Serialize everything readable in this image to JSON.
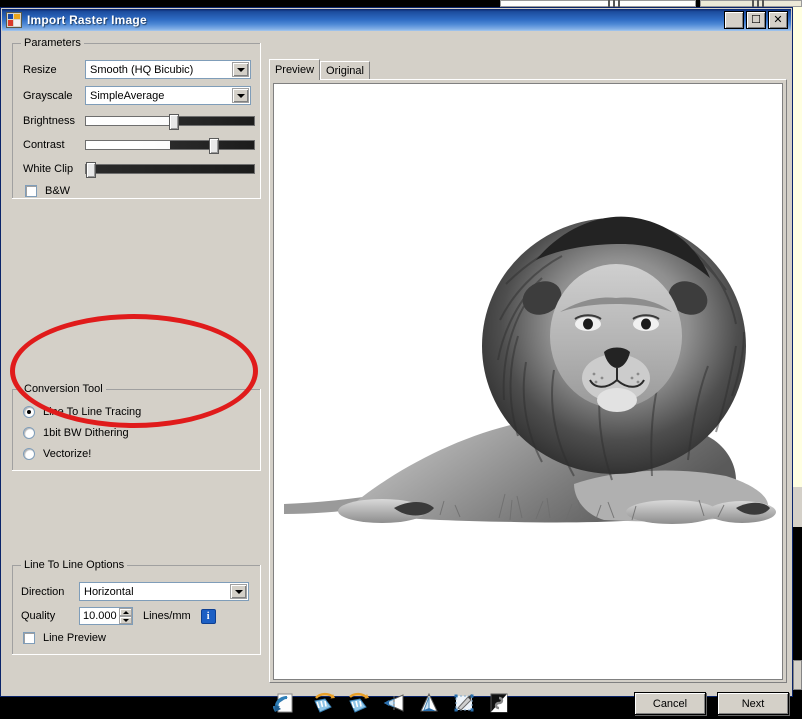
{
  "window": {
    "title": "Import Raster Image",
    "icon": "app-raster-icon",
    "controls": {
      "minimize": "_",
      "maximize": "☐",
      "close": "✕"
    }
  },
  "parameters": {
    "legend": "Parameters",
    "resize": {
      "label": "Resize",
      "value": "Smooth (HQ Bicubic)"
    },
    "grayscale": {
      "label": "Grayscale",
      "value": "SimpleAverage"
    },
    "brightness": {
      "label": "Brightness",
      "percent": 52
    },
    "contrast": {
      "label": "Contrast",
      "percent": 76
    },
    "white_clip": {
      "label": "White Clip",
      "percent": 1
    },
    "bw": {
      "label": "B&W",
      "checked": false
    }
  },
  "conversion_tool": {
    "legend": "Conversion Tool",
    "options": [
      {
        "label": "Line To Line Tracing",
        "selected": true
      },
      {
        "label": "1bit BW Dithering",
        "selected": false
      },
      {
        "label": "Vectorize!",
        "selected": false
      }
    ]
  },
  "line_options": {
    "legend": "Line To Line Options",
    "direction": {
      "label": "Direction",
      "value": "Horizontal"
    },
    "quality": {
      "label": "Quality",
      "value": "10.000",
      "units": "Lines/mm",
      "info": "i"
    },
    "line_preview": {
      "label": "Line Preview",
      "checked": false
    }
  },
  "annotation": {
    "shape": "red-ellipse-highlight",
    "color": "#e01b1b"
  },
  "preview": {
    "tabs": [
      {
        "label": "Preview",
        "selected": true
      },
      {
        "label": "Original",
        "selected": false
      }
    ],
    "image_alt": "Grayscale photo of a lion lying down"
  },
  "toolbar": {
    "icons": [
      "undo-icon",
      "rotate-left-icon",
      "rotate-right-icon",
      "flip-horizontal-icon",
      "flip-vertical-icon",
      "crop-icon",
      "invert-icon"
    ]
  },
  "buttons": {
    "cancel": "Cancel",
    "next": "Next"
  }
}
